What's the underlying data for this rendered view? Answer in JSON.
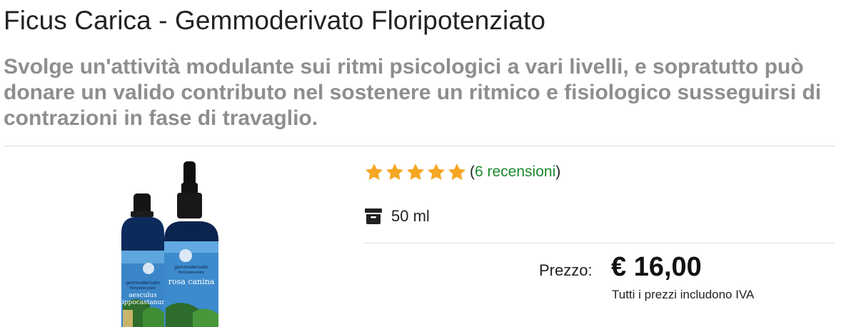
{
  "product": {
    "title": "Ficus Carica - Gemmoderivato Floripotenziato",
    "description": "Svolge un'attività modulante sui ritmi psicologici a vari livelli, e sopratutto può donare un valido contributo nel sostenere un ritmico e fisiologico susseguirsi di contrazioni in fase di travaglio."
  },
  "image": {
    "left_label_line1": "gemmoderivato",
    "left_label_line2": "floripotenziato",
    "left_label_name1": "aesculus",
    "left_label_name2": "hippocastanum",
    "right_label_line1": "gemmoderivato",
    "right_label_line2": "floripotenziato",
    "right_label_name": "rosa canina"
  },
  "rating": {
    "stars": 5,
    "max_stars": 5,
    "paren_open": "(",
    "reviews_label": "6 recensioni",
    "paren_close": " )"
  },
  "size": {
    "icon": "archive-box-icon",
    "value": "50 ml"
  },
  "price": {
    "label": "Prezzo:",
    "value": "€ 16,00",
    "note": "Tutti i prezzi includono IVA"
  },
  "colors": {
    "star": "#f5a623",
    "reviews_link": "#1d8a2e",
    "subtitle": "#8e8e8e"
  }
}
